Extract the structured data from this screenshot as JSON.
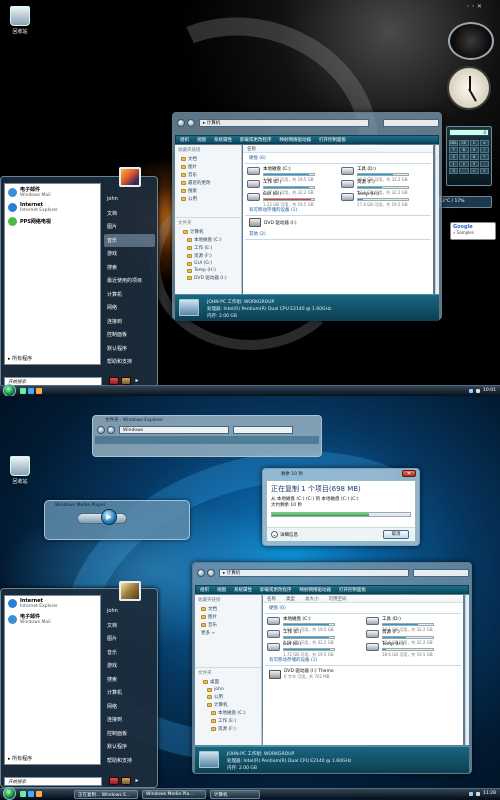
{
  "screen1": {
    "desktop_icon": "回收站",
    "start_menu": {
      "pinned": [
        {
          "title": "电子邮件",
          "subtitle": "Windows Mail",
          "icon": "mail-icon"
        },
        {
          "title": "Internet",
          "subtitle": "Internet Explorer",
          "icon": "ie-icon"
        },
        {
          "title": "PPS网络电视",
          "subtitle": "",
          "icon": "pps-icon"
        }
      ],
      "all_programs": "所有程序",
      "search_placeholder": "开始搜索",
      "right_items": [
        "john",
        "文档",
        "图片",
        "音乐",
        "游戏",
        "搜索",
        "最近使用的项目",
        "计算机",
        "网络",
        "连接到",
        "控制面板",
        "默认程序",
        "帮助和支持"
      ],
      "selected_index": 3
    },
    "explorer": {
      "address": "计算机",
      "toolbar": [
        "组织",
        "视图",
        "系统属性",
        "卸载或更改程序",
        "映射网络驱动器",
        "打开控制面板"
      ],
      "nav_header": "收藏夹链接",
      "nav_links": [
        "文档",
        "图片",
        "音乐",
        "最近的更改",
        "搜索",
        "公用"
      ],
      "folder_header": "文件夹",
      "tree": [
        "计算机",
        "本地磁盘 (C:)",
        "工作 (E:)",
        "资源 (F:)",
        "GUI (G:)",
        "Temp (H:)",
        "DVD 驱动器 (I:)"
      ],
      "group_hdd": "硬盘 (6)",
      "drives": [
        {
          "name": "本地磁盘 (C:)",
          "free": "1.96 GB 可用，共 19.5 GB",
          "pct": 90,
          "red": false
        },
        {
          "name": "工具 (D:)",
          "free": "10.0 GB 可用，共 32.2 GB",
          "pct": 69,
          "red": false
        },
        {
          "name": "工作 (E:)",
          "free": "3.47 GB 可用，共 32.2 GB",
          "pct": 89,
          "red": false
        },
        {
          "name": "资源 (F:)",
          "free": "17.1 GB 可用，共 32.2 GB",
          "pct": 47,
          "red": false
        },
        {
          "name": "GUI (G:)",
          "free": "1.22 GB 可用，共 19.5 GB",
          "pct": 94,
          "red": true
        },
        {
          "name": "Temp (H:)",
          "free": "17.8 GB 可用，共 19.5 GB",
          "pct": 9,
          "red": false
        }
      ],
      "group_removable": "有可移动存储的设备 (1)",
      "dvd": "DVD 驱动器 (I:)",
      "group_other": "其他 (2)",
      "details": [
        "JOHN-PC  工作组: WORKGROUP",
        "处理器: Intel(R) Pentium(R) Dual  CPU  E2140  @ 1.60GHz",
        "内存: 2.00 GB"
      ]
    },
    "gadgets": {
      "google": "Google",
      "google_sub": "» Samples",
      "weather": "13°C / 17%"
    },
    "taskbar": {
      "time": "10:01"
    }
  },
  "screen2": {
    "desktop_icon": "回收站",
    "mini_explorer": {
      "title": "文件夹 · Windows Explorer",
      "address": "Windows"
    },
    "wmp": {
      "title": "Windows Media Player"
    },
    "dialog": {
      "title": "剩余 10 秒",
      "heading": "正在复制 1 个项目(698 MB)",
      "line1": "从 本地磁盘 (C:) (C:) 到 本地磁盘 (C:) (C:)",
      "line2": "大约剩余 10 秒",
      "progress": 70,
      "details_label": "详细信息",
      "cancel_label": "取消"
    },
    "explorer": {
      "address": "计算机",
      "toolbar": [
        "组织",
        "视图",
        "系统属性",
        "卸载或更改程序",
        "映射网络驱动器",
        "打开控制面板"
      ],
      "nav_header": "收藏夹链接",
      "nav_links": [
        "文档",
        "图片",
        "音乐",
        "更多"
      ],
      "folder_header": "文件夹",
      "tree": [
        "桌面",
        "john",
        "公用",
        "计算机",
        "本地磁盘 (C:)",
        "工作 (E:)",
        "资源 (F:)"
      ],
      "columns": [
        "名称",
        "类型",
        "总大小",
        "可用空间"
      ],
      "group_hdd": "硬盘 (6)",
      "drives": [
        {
          "name": "本地磁盘 (C:)",
          "free": "2.04 GB 可用，共 19.5 GB",
          "pct": 90,
          "red": false
        },
        {
          "name": "工具 (D:)",
          "free": "10.1 GB 可用，共 32.2 GB",
          "pct": 69,
          "red": false
        },
        {
          "name": "工作 (E:)",
          "free": "3.56 GB 可用，共 32.2 GB",
          "pct": 89,
          "red": false
        },
        {
          "name": "资源 (F:)",
          "free": "17.6 GB 可用，共 32.2 GB",
          "pct": 45,
          "red": false
        },
        {
          "name": "GUI (G:)",
          "free": "1.72 GB 可用，共 19.5 GB",
          "pct": 91,
          "red": false
        },
        {
          "name": "Temp (H:)",
          "free": "18.6 GB 可用，共 19.5 GB",
          "pct": 5,
          "red": false
        }
      ],
      "group_removable": "有可移动存储的设备 (1)",
      "dvd": "DVD 驱动器 (I:) Theme",
      "dvd_sub": "0 字节 可用，共 702 MB",
      "details": [
        "JOHN-PC  工作组: WORKGROUP",
        "处理器: Intel(R) Pentium(R) Dual  CPU  E2140  @ 1.60GHz",
        "内存: 2.00 GB"
      ]
    },
    "start_menu": {
      "pinned": [
        {
          "title": "Internet",
          "subtitle": "Internet Explorer",
          "icon": "ie-icon"
        },
        {
          "title": "电子邮件",
          "subtitle": "Windows Mail",
          "icon": "mail-icon"
        }
      ],
      "all_programs": "所有程序",
      "search_placeholder": "开始搜索",
      "right_items": [
        "john",
        "文档",
        "图片",
        "音乐",
        "游戏",
        "搜索",
        "计算机",
        "网络",
        "连接到",
        "控制面板",
        "默认程序",
        "帮助和支持"
      ]
    },
    "taskbar": {
      "buttons": [
        "正在复制... Windows E...",
        "Windows Media Pla...",
        "计算机"
      ],
      "time": "11:28"
    }
  }
}
